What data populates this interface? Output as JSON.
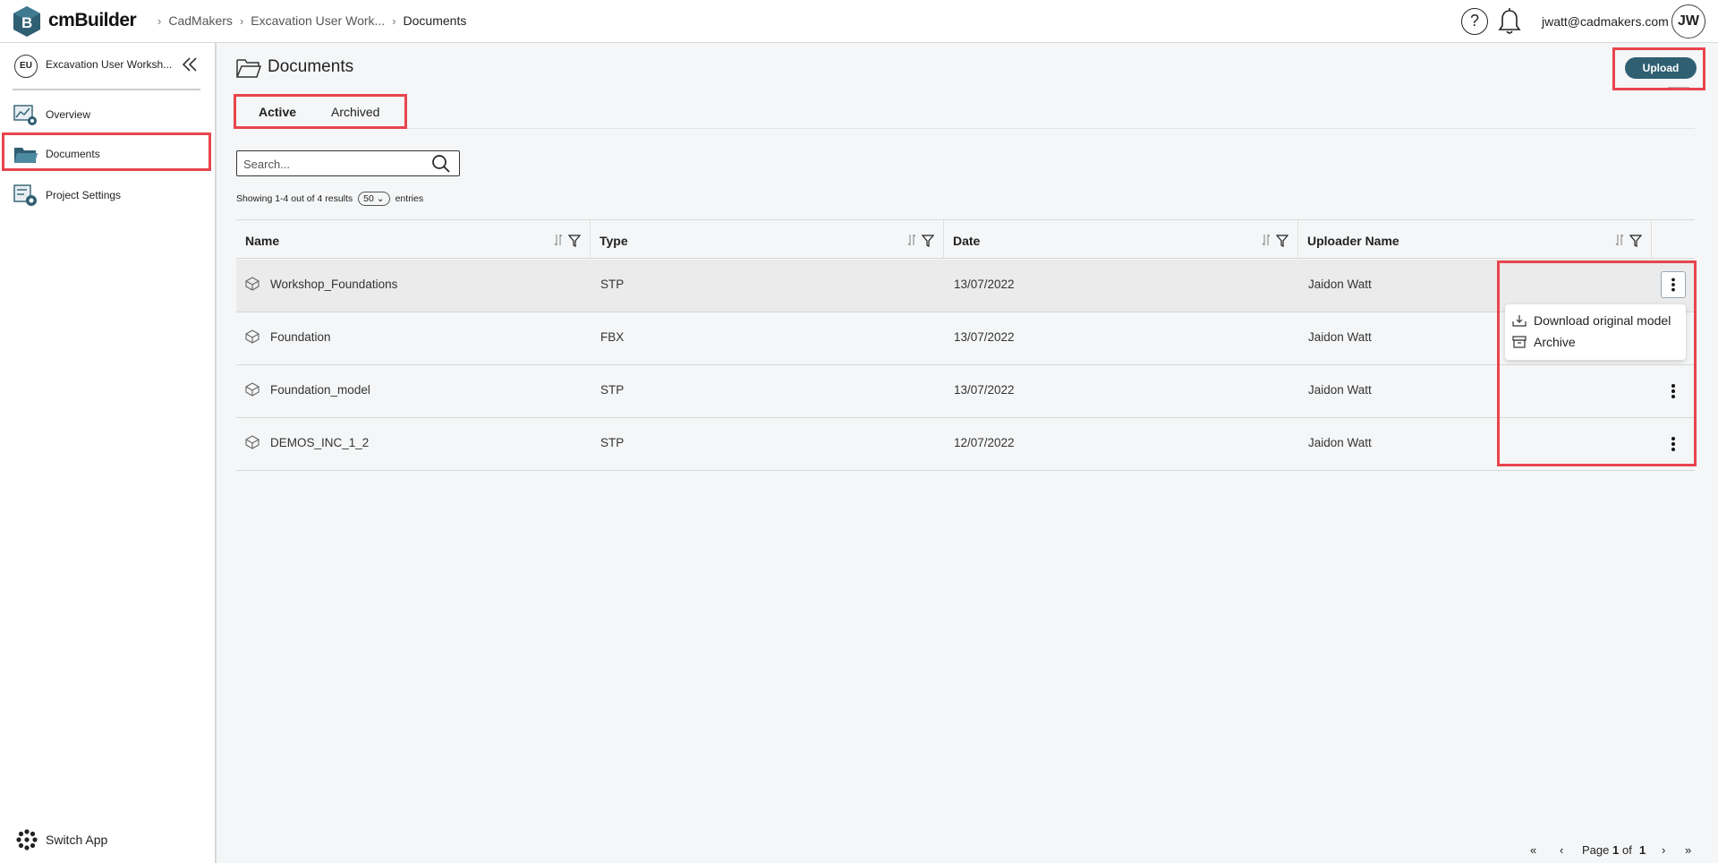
{
  "app": {
    "name": "cmBuilder"
  },
  "breadcrumb": [
    "CadMakers",
    "Excavation User Work...",
    "Documents"
  ],
  "header": {
    "help_glyph": "?",
    "user_email": "jwatt@cadmakers.com",
    "user_initials": "JW"
  },
  "sidebar": {
    "project_initials": "EU",
    "project_name": "Excavation User Worksh...",
    "items": [
      {
        "label": "Overview",
        "icon": "overview-icon"
      },
      {
        "label": "Documents",
        "icon": "folder-icon"
      },
      {
        "label": "Project Settings",
        "icon": "settings-icon"
      }
    ],
    "switch_app": "Switch App"
  },
  "page": {
    "title": "Documents",
    "upload_label": "Upload",
    "tabs": [
      "Active",
      "Archived"
    ],
    "active_tab": "Active",
    "search_placeholder": "Search...",
    "showing_text": "Showing 1-4 out of 4 results",
    "entries_value": "50",
    "entries_label": "entries"
  },
  "table": {
    "columns": [
      "Name",
      "Type",
      "Date",
      "Uploader Name"
    ],
    "rows": [
      {
        "name": "Workshop_Foundations",
        "type": "STP",
        "date": "13/07/2022",
        "uploader": "Jaidon Watt"
      },
      {
        "name": "Foundation",
        "type": "FBX",
        "date": "13/07/2022",
        "uploader": "Jaidon Watt"
      },
      {
        "name": "Foundation_model",
        "type": "STP",
        "date": "13/07/2022",
        "uploader": "Jaidon Watt"
      },
      {
        "name": "DEMOS_INC_1_2",
        "type": "STP",
        "date": "12/07/2022",
        "uploader": "Jaidon Watt"
      }
    ]
  },
  "row_menu": {
    "items": [
      "Download original model",
      "Archive"
    ]
  },
  "pagination": {
    "first": "«",
    "prev": "‹",
    "page_prefix": "Page",
    "page": "1",
    "of": "of",
    "total": "1",
    "next": "›",
    "last": "»"
  },
  "colors": {
    "accent": "#2f5f72",
    "highlight": "#e8454c"
  }
}
